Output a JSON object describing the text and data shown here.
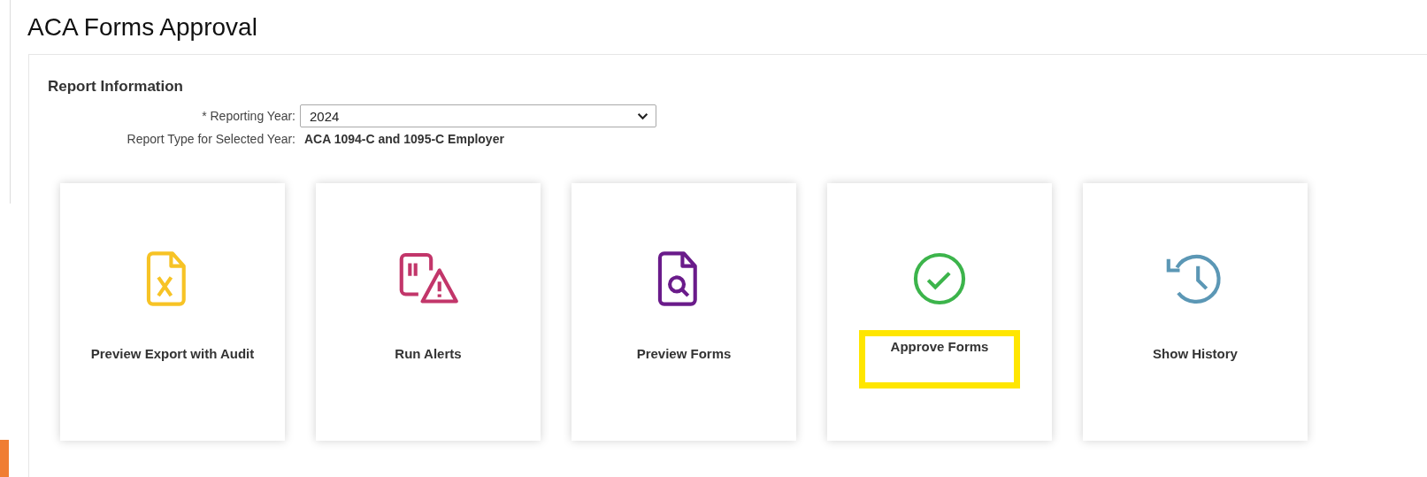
{
  "page_title": "ACA Forms Approval",
  "report_information": {
    "heading": "Report Information",
    "reporting_year": {
      "required_mark": "*",
      "label": "Reporting Year:",
      "value": "2024"
    },
    "report_type": {
      "label": "Report Type for Selected Year:",
      "value": "ACA 1094-C and 1095-C Employer"
    }
  },
  "tiles": [
    {
      "kind": "export",
      "label": "Preview Export with Audit",
      "color": "#f7c325",
      "highlighted": false
    },
    {
      "kind": "alerts",
      "label": "Run Alerts",
      "color": "#c2366a",
      "highlighted": false
    },
    {
      "kind": "preview",
      "label": "Preview Forms",
      "color": "#6a1b8a",
      "highlighted": false
    },
    {
      "kind": "approve",
      "label": "Approve Forms",
      "color": "#3cb44b",
      "highlighted": true
    },
    {
      "kind": "history",
      "label": "Show History",
      "color": "#5b97b5",
      "highlighted": false
    }
  ]
}
